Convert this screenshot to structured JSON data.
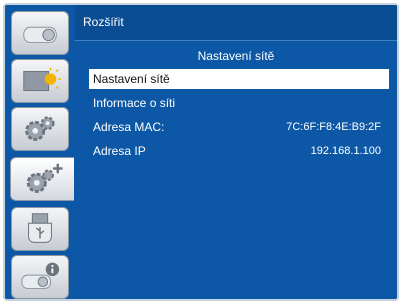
{
  "header": {
    "title": "Rozšířit"
  },
  "section": {
    "title": "Nastavení sítě"
  },
  "rows": [
    {
      "label": "Nastavení sítě",
      "value": ""
    },
    {
      "label": "Informace o síti",
      "value": ""
    },
    {
      "label": "Adresa MAC:",
      "value": "7C:6F:F8:4E:B9:2F"
    },
    {
      "label": "Adresa IP",
      "value": "192.168.1.100"
    }
  ],
  "sidebar": {
    "tabs": [
      {
        "icon": "projector-icon"
      },
      {
        "icon": "picture-brightness-icon"
      },
      {
        "icon": "settings-gears-icon"
      },
      {
        "icon": "extended-settings-icon"
      },
      {
        "icon": "usb-icon"
      },
      {
        "icon": "info-icon"
      }
    ],
    "active_index": 3
  },
  "colors": {
    "background": "#0d58a6",
    "header": "#0a4d95",
    "selected_row": "#ffffff"
  }
}
